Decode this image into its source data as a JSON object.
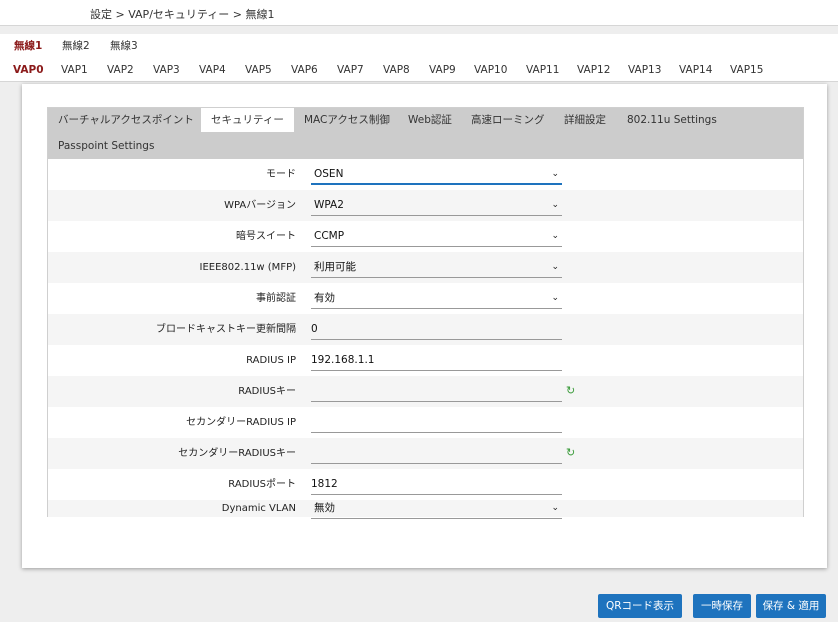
{
  "breadcrumb": "設定 > VAP/セキュリティー > 無線1",
  "radio_tabs": [
    {
      "label": "無線1",
      "active": true
    },
    {
      "label": "無線2",
      "active": false
    },
    {
      "label": "無線3",
      "active": false
    }
  ],
  "vap_tabs": [
    {
      "label": "VAP0",
      "active": true
    },
    {
      "label": "VAP1"
    },
    {
      "label": "VAP2"
    },
    {
      "label": "VAP3"
    },
    {
      "label": "VAP4"
    },
    {
      "label": "VAP5"
    },
    {
      "label": "VAP6"
    },
    {
      "label": "VAP7"
    },
    {
      "label": "VAP8"
    },
    {
      "label": "VAP9"
    },
    {
      "label": "VAP10"
    },
    {
      "label": "VAP11"
    },
    {
      "label": "VAP12"
    },
    {
      "label": "VAP13"
    },
    {
      "label": "VAP14"
    },
    {
      "label": "VAP15"
    }
  ],
  "section_tabs": [
    {
      "label": "バーチャルアクセスポイント"
    },
    {
      "label": "セキュリティー",
      "active": true
    },
    {
      "label": "MACアクセス制御"
    },
    {
      "label": "Web認証"
    },
    {
      "label": "高速ローミング"
    },
    {
      "label": "詳細設定"
    },
    {
      "label": "802.11u Settings"
    },
    {
      "label": "Passpoint Settings"
    }
  ],
  "form": {
    "mode": {
      "label": "モード",
      "value": "OSEN"
    },
    "wpa_version": {
      "label": "WPAバージョン",
      "value": "WPA2"
    },
    "cipher_suite": {
      "label": "暗号スイート",
      "value": "CCMP"
    },
    "mfp": {
      "label": "IEEE802.11w (MFP)",
      "value": "利用可能"
    },
    "preauth": {
      "label": "事前認証",
      "value": "有効"
    },
    "broadcast_key_interval": {
      "label": "ブロードキャストキー更新間隔",
      "value": "0"
    },
    "radius_ip": {
      "label": "RADIUS IP",
      "value": "192.168.1.1"
    },
    "radius_key": {
      "label": "RADIUSキー",
      "value": ""
    },
    "secondary_radius_ip": {
      "label": "セカンダリーRADIUS IP",
      "value": ""
    },
    "secondary_radius_key": {
      "label": "セカンダリーRADIUSキー",
      "value": ""
    },
    "radius_port": {
      "label": "RADIUSポート",
      "value": "1812"
    },
    "dynamic_vlan": {
      "label": "Dynamic VLAN",
      "value": "無効"
    }
  },
  "icons": {
    "chevron": "chevron-down-icon",
    "refresh": "refresh-icon"
  },
  "colors": {
    "accent": "#1e73be",
    "active_tab": "#8b1a1a",
    "refresh_icon": "#3a9b3a"
  },
  "buttons": {
    "qr": "QRコード表示",
    "save_temp": "一時保存",
    "save_apply": "保存 & 適用"
  }
}
